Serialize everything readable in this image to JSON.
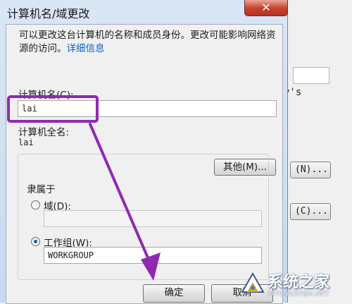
{
  "dialog": {
    "title": "计算机名/域更改",
    "close_glyph": "✕",
    "intro_text": "可以更改这台计算机的名称和成员身份。更改可能影响网络资源的访问。",
    "details_link": "详细信息",
    "computer_name_label": "计算机名(C):",
    "computer_name_value": "lai",
    "full_name_label": "计算机全名:",
    "full_name_value": "lai",
    "other_button": "其他(M)...",
    "member_of_label": "隶属于",
    "domain_label": "域(D):",
    "domain_value": "",
    "workgroup_label": "工作组(W):",
    "workgroup_value": "WORKGROUP",
    "ok_button": "确定",
    "cancel_button": "取消"
  },
  "background_window": {
    "partial_text": "y's",
    "button1_label": "(N)...",
    "button2_label": "(C)..."
  },
  "watermark": {
    "name": "系统之家",
    "url": "XITONGZHIJIA.NET"
  },
  "colors": {
    "highlight": "#8f2ab0",
    "link": "#0b64c8",
    "close": "#c8452f"
  }
}
